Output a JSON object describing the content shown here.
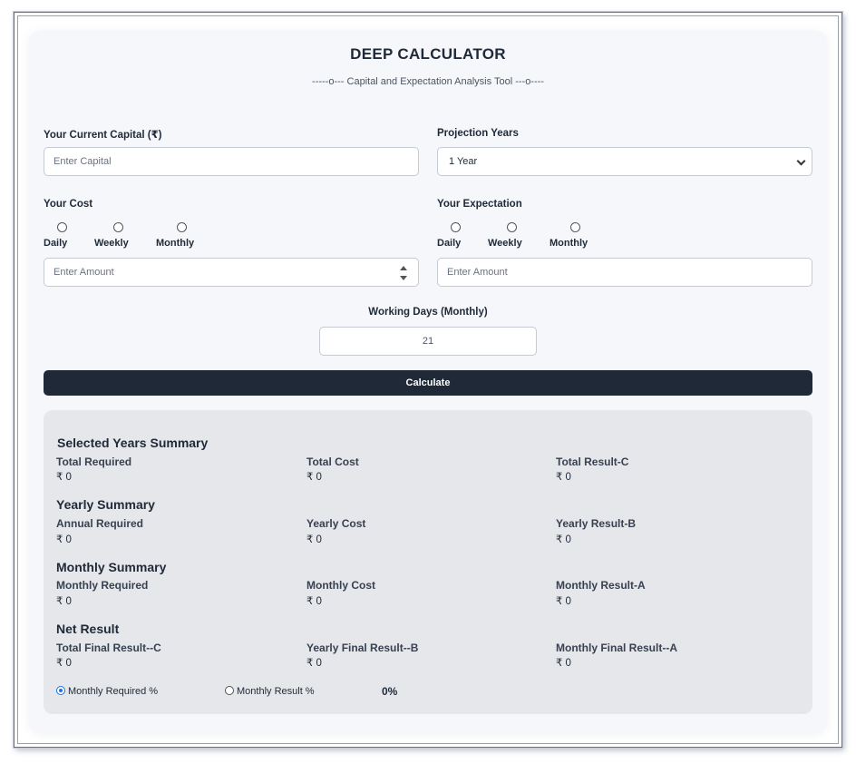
{
  "header": {
    "title": "DEEP CALCULATOR",
    "subtitle": "-----o--- Capital and Expectation Analysis Tool ---o----"
  },
  "form": {
    "capital_label": "Your Current Capital (₹)",
    "capital_placeholder": "Enter Capital",
    "years_label": "Projection Years",
    "years_selected": "1 Year",
    "cost_label": "Your Cost",
    "cost_options": [
      "Daily",
      "Weekly",
      "Monthly"
    ],
    "cost_placeholder": "Enter Amount",
    "expectation_label": "Your Expectation",
    "expectation_options": [
      "Daily",
      "Weekly",
      "Monthly"
    ],
    "expectation_placeholder": "Enter Amount",
    "working_days_label": "Working Days (Monthly)",
    "working_days_value": "21",
    "calculate_label": "Calculate"
  },
  "results": {
    "selected_years": {
      "title": "Selected Years Summary",
      "items": [
        {
          "label": "Total Required",
          "value": "₹ 0"
        },
        {
          "label": "Total Cost",
          "value": "₹ 0"
        },
        {
          "label": "Total Result-C",
          "value": "₹ 0"
        }
      ]
    },
    "yearly": {
      "title": "Yearly Summary",
      "items": [
        {
          "label": "Annual Required",
          "value": "₹ 0"
        },
        {
          "label": "Yearly Cost",
          "value": "₹ 0"
        },
        {
          "label": "Yearly Result-B",
          "value": "₹ 0"
        }
      ]
    },
    "monthly": {
      "title": "Monthly Summary",
      "items": [
        {
          "label": "Monthly Required",
          "value": "₹ 0"
        },
        {
          "label": "Monthly Cost",
          "value": "₹ 0"
        },
        {
          "label": "Monthly Result-A",
          "value": "₹ 0"
        }
      ]
    },
    "net": {
      "title": "Net Result",
      "items": [
        {
          "label": "Total Final Result--C",
          "value": "₹ 0"
        },
        {
          "label": "Yearly Final Result--B",
          "value": "₹ 0"
        },
        {
          "label": "Monthly Final Result--A",
          "value": "₹ 0"
        }
      ]
    },
    "percent_toggle": {
      "option_1": "Monthly Required %",
      "option_2": "Monthly Result %",
      "selected": "Monthly Required %",
      "value": "0%"
    }
  }
}
